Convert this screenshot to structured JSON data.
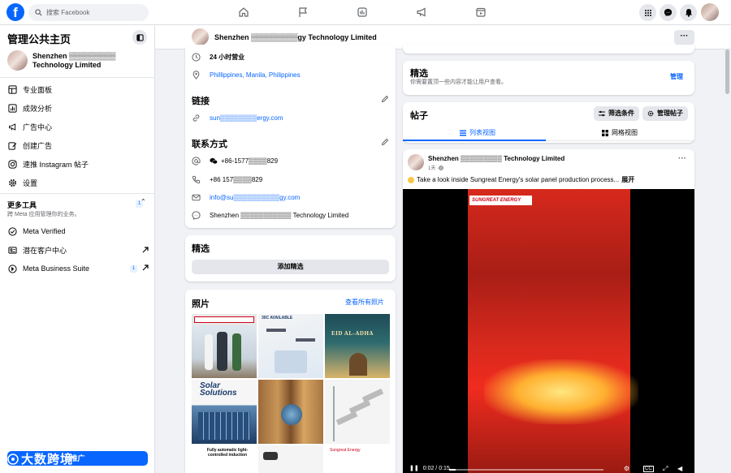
{
  "topbar": {
    "search_placeholder": "搜索 Facebook",
    "logo_letter": "f",
    "nav_icons": [
      "home-icon",
      "flag-icon",
      "insights-icon",
      "megaphone-icon",
      "calendar-play-icon"
    ],
    "right_icons": [
      "menu-grid-icon",
      "messenger-icon",
      "bell-icon"
    ]
  },
  "sidebar": {
    "title": "管理公共主页",
    "page_name": "Shenzhen ▒▒▒▒▒▒▒▒▒ Technology Limited",
    "items": [
      {
        "label": "专业面板",
        "icon": "dashboard-icon"
      },
      {
        "label": "成效分析",
        "icon": "chart-icon"
      },
      {
        "label": "广告中心",
        "icon": "megaphone-icon"
      },
      {
        "label": "创建广告",
        "icon": "edit-icon"
      },
      {
        "label": "速推 Instagram 帖子",
        "icon": "instagram-icon"
      },
      {
        "label": "设置",
        "icon": "gear-icon"
      }
    ],
    "tools_title": "更多工具",
    "tools_badge": "1",
    "tools_subtitle": "跨 Meta 应用管理你的业务。",
    "tools": [
      {
        "label": "Meta Verified",
        "icon": "verified-icon"
      },
      {
        "label": "潜在客户中心",
        "icon": "leads-icon"
      },
      {
        "label": "Meta Business Suite",
        "icon": "meta-suite-icon",
        "badge": "1"
      }
    ],
    "promote_label": "推广",
    "watermark": "大数跨境"
  },
  "pagebar": {
    "page_name": "Shenzhen ▒▒▒▒▒▒▒▒▒gy Technology Limited",
    "more_label": "···"
  },
  "intro_card": {
    "hours": "24 小时营业",
    "location": "Phillippines, Manila, Philippines",
    "links_title": "链接",
    "website": "sun▒▒▒▒▒▒▒▒ergy.com",
    "contact_title": "联系方式",
    "wechat": "+86-1577▒▒▒▒829",
    "phone": "+86 157▒▒▒▒829",
    "email": "info@su▒▒▒▒▒▒▒▒▒▒gy.com",
    "messenger": "Shenzhen ▒▒▒▒▒▒▒▒▒▒▒ Technology Limited"
  },
  "featured_card": {
    "title": "精选",
    "button": "添加精选"
  },
  "photos_card": {
    "title": "照片",
    "see_all": "查看所有照片",
    "photo_texts": [
      "",
      "30C AVAILABLE",
      "EID AL-ADHA",
      "Solar Solutions",
      "",
      "",
      "Fully automatic light-controlled induction",
      "",
      "Sungreat Energy"
    ]
  },
  "featured_right": {
    "title": "精选",
    "subtitle": "你需要置顶一些内容才能让用户查看。",
    "manage": "管理"
  },
  "posts": {
    "title": "帖子",
    "filter_label": "筛选条件",
    "manage_label": "管理帖子",
    "tab_list": "列表视图",
    "tab_grid": "网格视图"
  },
  "post": {
    "author": "Shenzhen ▒▒▒▒▒▒▒▒▒ Technology Limited",
    "time": "1天 · ",
    "text": "Take a look inside Sungreat Energy's solar panel production process...",
    "expand": "展开",
    "video_logo": "SUNGREAT ENERGY",
    "video_time": "0:02 / 0:15",
    "video_progress": 0.04
  },
  "colors": {
    "brand": "#0866ff",
    "bg": "#f0f2f5"
  }
}
